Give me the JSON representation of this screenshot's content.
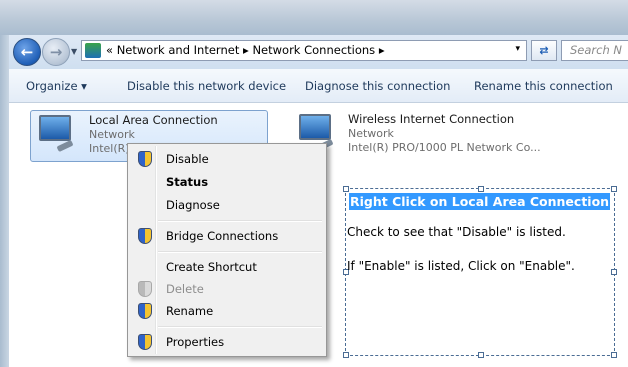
{
  "address_bar": {
    "chevrons": "«",
    "crumb_1": "Network and Internet",
    "sep": "▸",
    "crumb_2": "Network Connections",
    "drop": "▾"
  },
  "search": {
    "placeholder": "Search N"
  },
  "toolbar": {
    "organize": "Organize ▾",
    "disable_device": "Disable this network device",
    "diagnose": "Diagnose this connection",
    "rename": "Rename this connection"
  },
  "connections": [
    {
      "name": "Local Area Connection",
      "type": "Network",
      "adapter": "Intel(R)"
    },
    {
      "name": "Wireless Internet Connection",
      "type": "Network",
      "adapter": "Intel(R) PRO/1000 PL Network Co..."
    }
  ],
  "context_menu": {
    "items": [
      {
        "label": "Disable",
        "icon": "shield-icon"
      },
      {
        "label": "Status"
      },
      {
        "label": "Diagnose"
      },
      {
        "label": "Bridge Connections",
        "icon": "shield-icon"
      },
      {
        "label": "Create Shortcut"
      },
      {
        "label": "Delete",
        "icon": "shield-icon"
      },
      {
        "label": "Rename",
        "icon": "shield-icon"
      },
      {
        "label": "Properties",
        "icon": "shield-icon"
      }
    ]
  },
  "annotation": {
    "title": "Right Click on Local Area Connection",
    "line1": "Check to see that \"Disable\" is listed.",
    "line2": "If \"Enable\" is listed, Click on \"Enable\"."
  },
  "colors": {
    "highlight": "#3399ff",
    "menu_bg": "#f0f0f0",
    "tile_bg": "#d4e6fb"
  }
}
